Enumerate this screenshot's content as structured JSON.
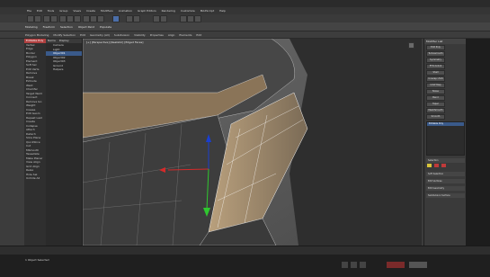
{
  "menu": [
    "File",
    "Edit",
    "Tools",
    "Group",
    "Views",
    "Create",
    "Modifiers",
    "Animation",
    "Graph Editors",
    "Rendering",
    "Customize",
    "MAXScript",
    "Help"
  ],
  "ribbon": {
    "tabs": [
      "Modeling",
      "Freeform",
      "Selection",
      "Object Paint",
      "Populate"
    ],
    "subtabs": [
      "Polygon Modeling",
      "Modify Selection",
      "Edit",
      "Geometry (All)",
      "Subdivision",
      "Visibility",
      "Properties",
      "Align",
      "Elements",
      "Edit"
    ]
  },
  "left_panel": {
    "items": [
      "Editable Poly",
      "Vertex",
      "Edge",
      "Border",
      "Polygon",
      "Element",
      "Soft Sel",
      "Edit Verts",
      "Remove",
      "Break",
      "Extrude",
      "Weld",
      "Chamfer",
      "Target Weld",
      "Connect",
      "Remove Iso",
      "Weight",
      "Crease",
      "Edit Geom",
      "Repeat Last",
      "Create",
      "Collapse",
      "Attach",
      "Detach",
      "Slice Plane",
      "QuickSlice",
      "Cut",
      "MSmooth",
      "Tessellate",
      "Make Planar",
      "View Align",
      "Grid Align",
      "Relax",
      "Hide Sel",
      "Unhide All"
    ]
  },
  "scene_panel": {
    "headers": [
      "Name",
      "Display"
    ],
    "rows": [
      "Camera",
      "Light",
      "Object01",
      "Object02",
      "Object03",
      "Ground",
      "Helpers"
    ]
  },
  "viewport": {
    "label": "[+] [Perspective] [Realistic] [Edged Faces]"
  },
  "right_panel": {
    "title": "Modifier List",
    "buttons": [
      "Edit Poly",
      "Turbosmooth",
      "Symmetry",
      "FFD 2x2x2",
      "Shell",
      "Unwrap UVW",
      "UVW Map",
      "Noise",
      "Bend",
      "Taper",
      "MeshSmooth",
      "Smooth"
    ],
    "stack_selected": "Editable Poly",
    "sections": [
      "Selection",
      "Soft Selection",
      "Edit Vertices",
      "Edit Geometry",
      "Subdivision Surface"
    ]
  },
  "status": {
    "text": "1 Object Selected"
  },
  "colors": {
    "accent_red": "#b04040",
    "selection_blue": "#3a5a8a",
    "gizmo_blue": "#1a3fd0",
    "gizmo_green": "#2fc72f",
    "gizmo_red": "#d42a2a"
  }
}
